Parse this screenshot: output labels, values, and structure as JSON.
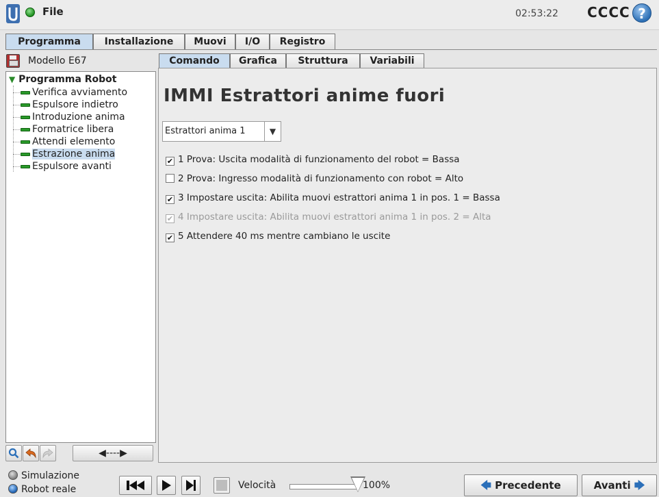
{
  "header": {
    "menu_label": "File",
    "clock": "02:53:22",
    "robot_name": "CCCC",
    "help_glyph": "?"
  },
  "main_tabs": [
    {
      "label": "Programma",
      "active": true
    },
    {
      "label": "Installazione",
      "active": false
    },
    {
      "label": "Muovi",
      "active": false
    },
    {
      "label": "I/O",
      "active": false
    },
    {
      "label": "Registro",
      "active": false
    }
  ],
  "program": {
    "file_name": "Modello E67",
    "root_label": "Programma Robot",
    "items": [
      {
        "label": "Verifica avviamento"
      },
      {
        "label": "Espulsore indietro"
      },
      {
        "label": "Introduzione anima"
      },
      {
        "label": "Formatrice libera"
      },
      {
        "label": "Attendi elemento"
      },
      {
        "label": "Estrazione anima",
        "selected": true
      },
      {
        "label": "Espulsore avanti"
      }
    ],
    "toolbar": {
      "search_icon": "search-icon",
      "undo_icon": "undo-icon",
      "redo_icon": "redo-icon",
      "move_label": "◀----▶"
    }
  },
  "sub_tabs": [
    {
      "label": "Comando",
      "active": true
    },
    {
      "label": "Grafica",
      "active": false
    },
    {
      "label": "Struttura",
      "active": false
    },
    {
      "label": "Variabili",
      "active": false
    }
  ],
  "command": {
    "title": "IMMI Estrattori anime fuori",
    "selector_value": "Estrattori anima 1",
    "conditions": [
      {
        "label": "1 Prova: Uscita modalità di funzionamento del robot = Bassa",
        "checked": true,
        "enabled": true
      },
      {
        "label": "2 Prova: Ingresso modalità di funzionamento con robot = Alto",
        "checked": false,
        "enabled": true
      },
      {
        "label": "3 Impostare uscita: Abilita muovi estrattori anima 1 in pos. 1 = Bassa",
        "checked": true,
        "enabled": true
      },
      {
        "label": "4 Impostare uscita: Abilita muovi estrattori anima 1 in pos. 2 = Alta",
        "checked": true,
        "enabled": false
      },
      {
        "label": "5 Attendere 40 ms mentre cambiano le uscite",
        "checked": true,
        "enabled": true
      }
    ]
  },
  "footer": {
    "mode_simulation": "Simulazione",
    "mode_real": "Robot reale",
    "selected_mode": "Robot reale",
    "speed_label": "Velocità",
    "speed_value": "100%",
    "speed_fraction": 1.0,
    "prev_label": "Precedente",
    "next_label": "Avanti"
  },
  "colors": {
    "accent": "#c9dcef",
    "status_green": "#1f8f1f",
    "brand_blue": "#2c6fb5"
  }
}
